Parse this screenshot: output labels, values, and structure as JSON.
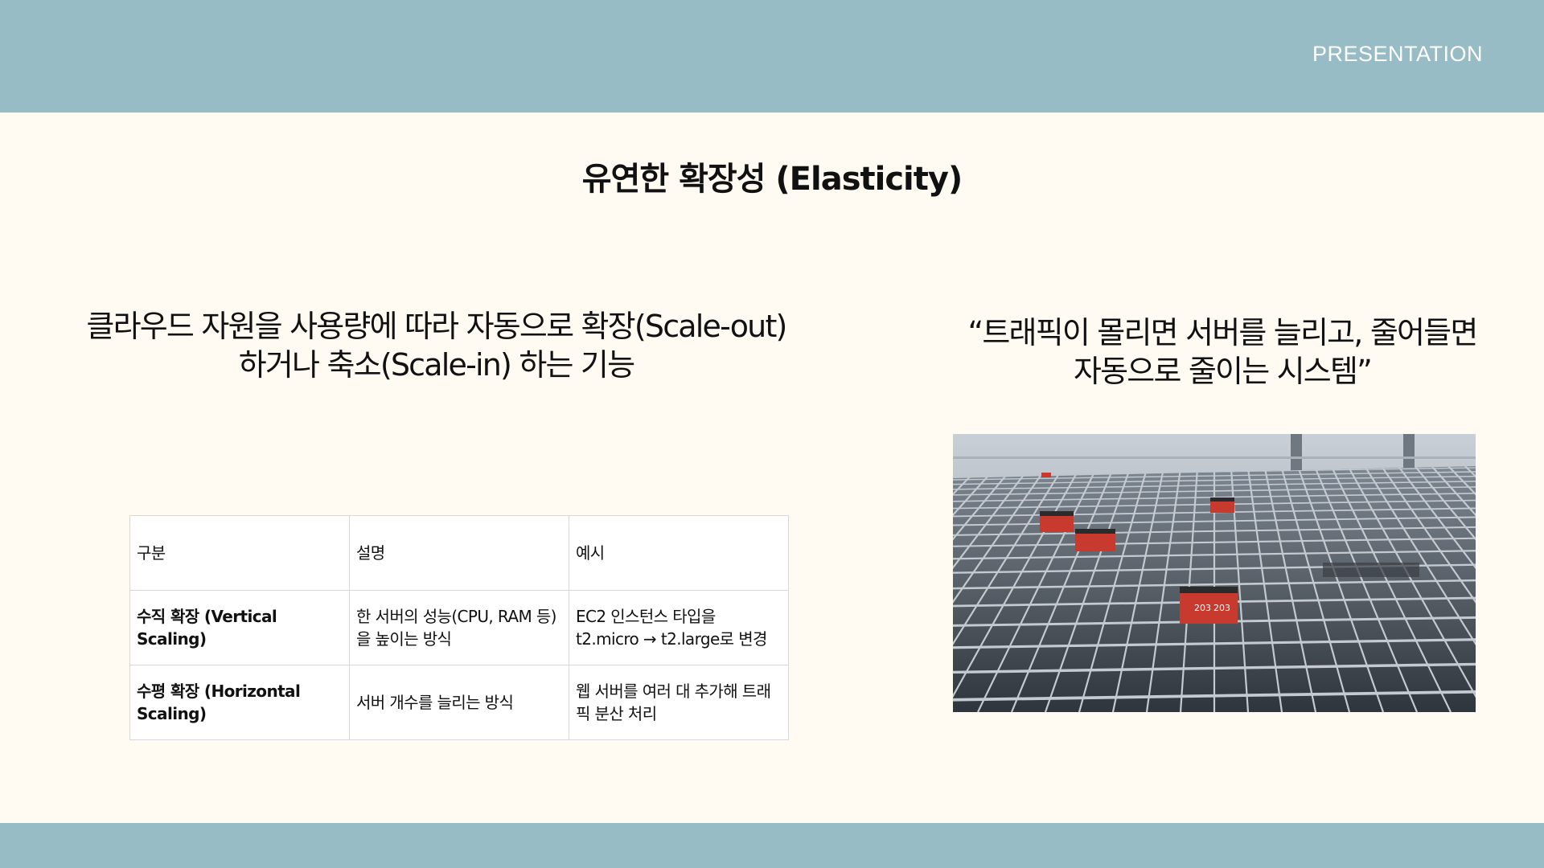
{
  "header": {
    "brand": "PRESENTATION"
  },
  "slide": {
    "title": "유연한 확장성 (Elasticity)",
    "lead_line1": "클라우드 자원을 사용량에 따라 자동으로 확장(Scale-out)",
    "lead_line2": "하거나 축소(Scale-in) 하는 기능",
    "quote_line1": "“트래픽이 몰리면 서버를 늘리고, 줄어들면",
    "quote_line2": "자동으로 줄이는 시스템”"
  },
  "table": {
    "headers": [
      "구분",
      "설명",
      "예시"
    ],
    "rows": [
      [
        "수직 확장 (Vertical Scaling)",
        "한 서버의 성능(CPU, RAM 등)을 높이는 방식",
        "EC2 인스턴스 타입을 t2.micro → t2.large로 변경"
      ],
      [
        "수평 확장 (Horizontal Scaling)",
        "서버 개수를 늘리는 방식",
        "웹 서버를 여러 대 추가해 트래픽 분산 처리"
      ]
    ]
  },
  "image": {
    "robot_labels": [
      "203",
      "203"
    ]
  },
  "colors": {
    "band": "#97bcc6",
    "background": "#fffbf3",
    "robot": "#c8392e"
  }
}
